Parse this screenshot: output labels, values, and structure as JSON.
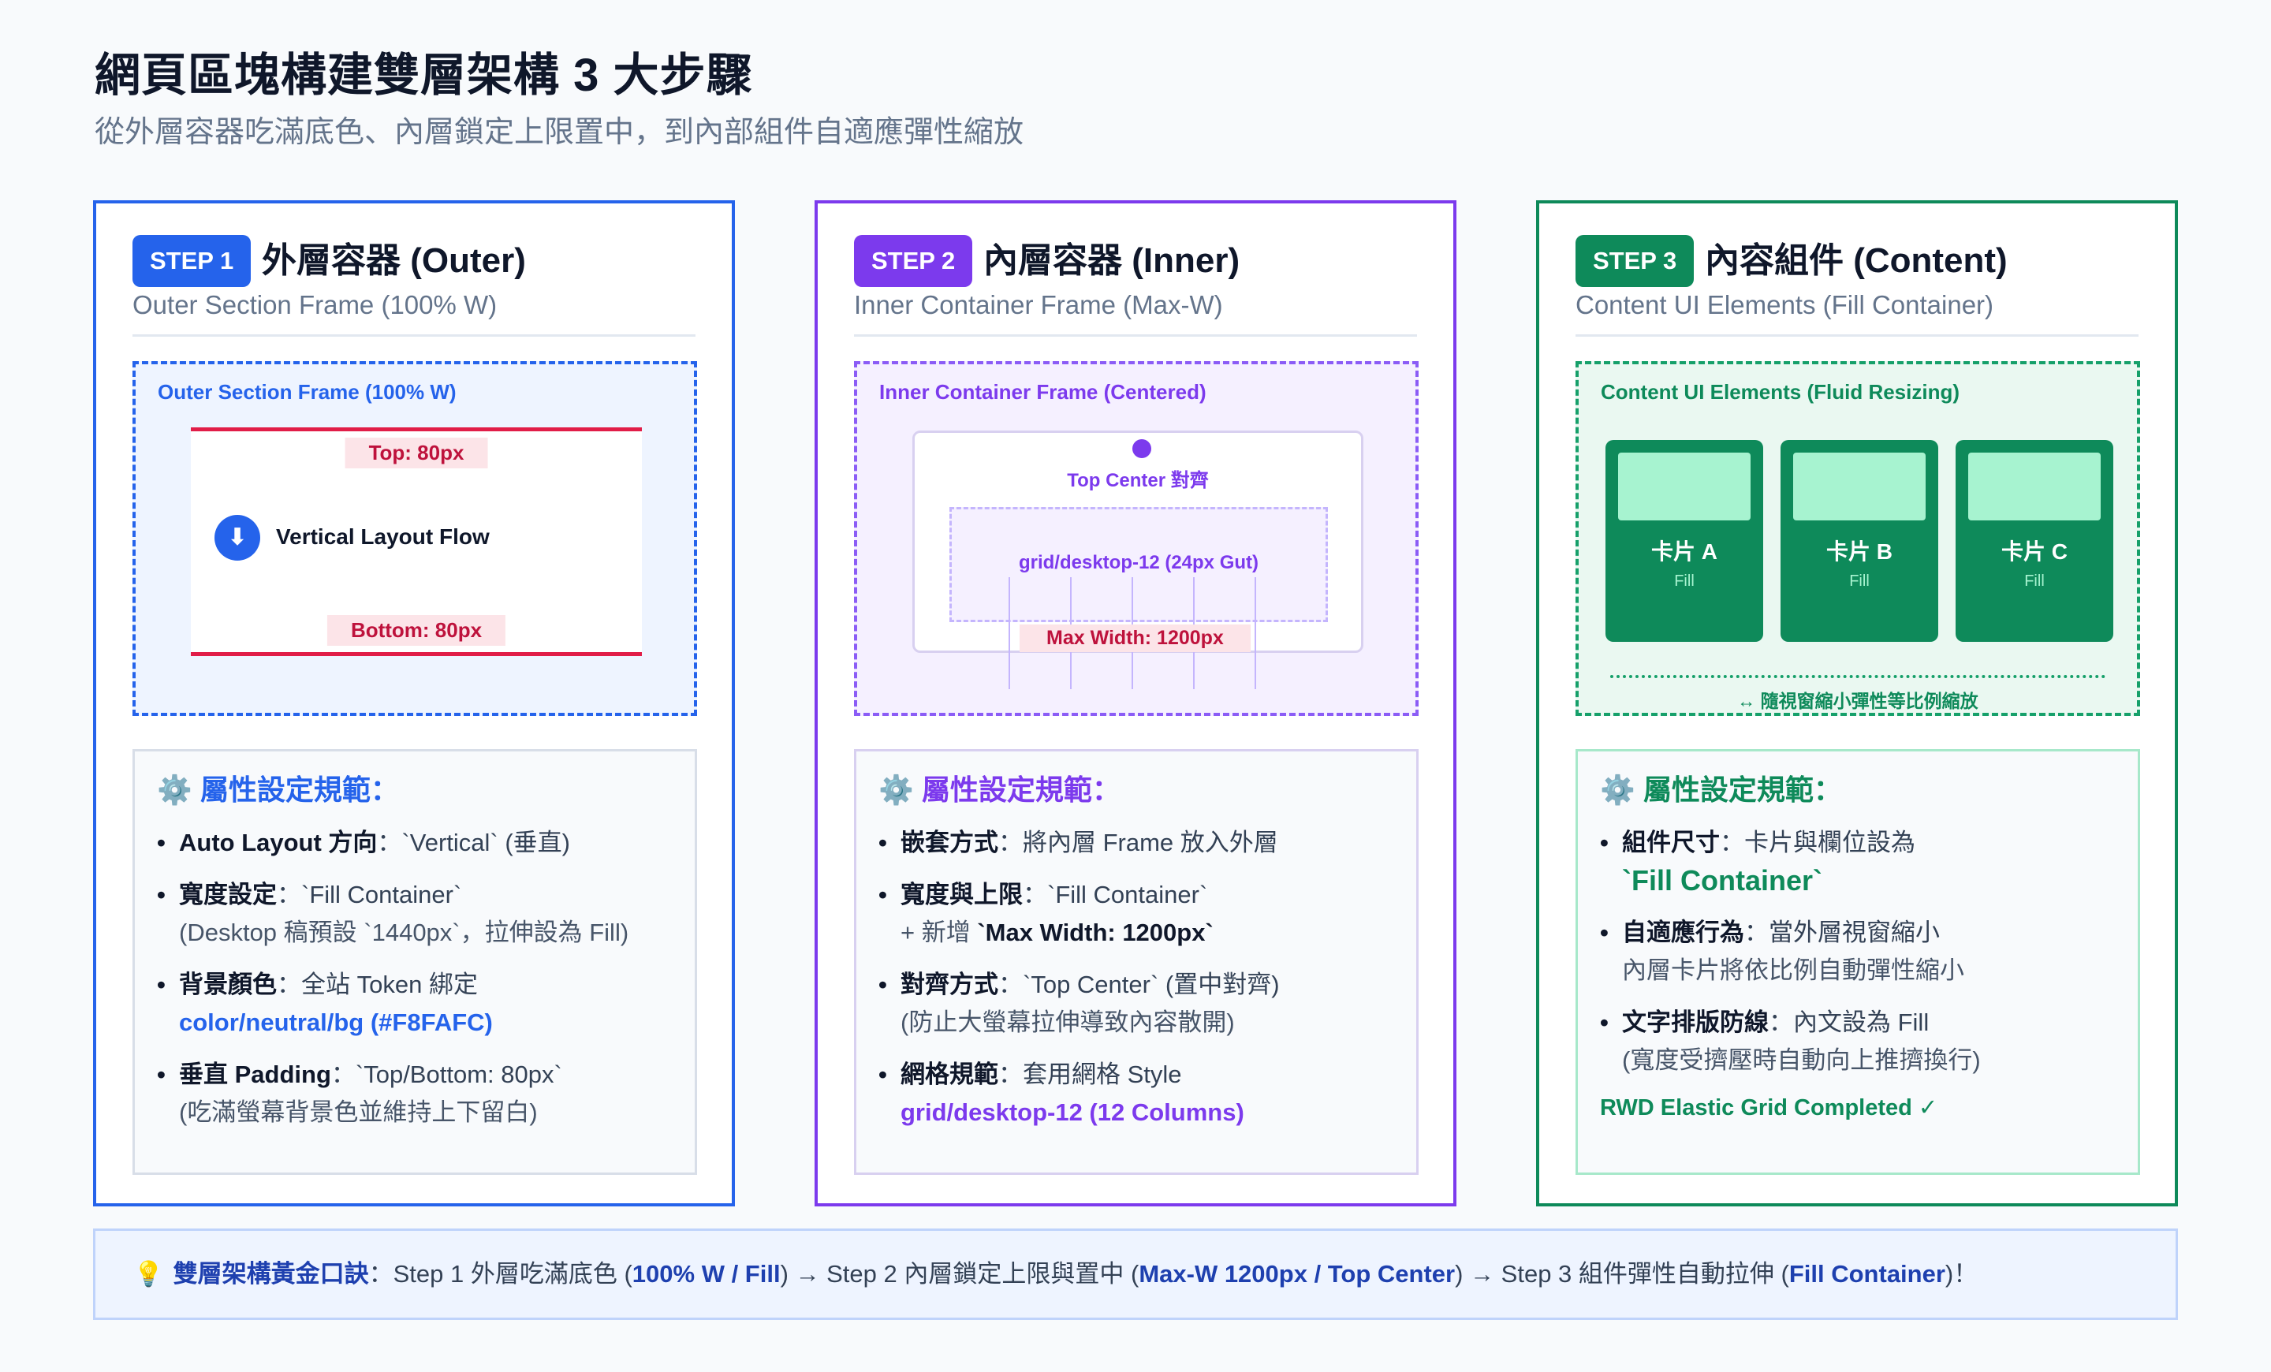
{
  "header": {
    "title": "網頁區塊構建雙層架構 3 大步驟",
    "subtitle": "從外層容器吃滿底色、內層鎖定上限置中，到內部組件自適應彈性縮放"
  },
  "colors": {
    "step1": "#2563EB",
    "step2": "#7C3AED",
    "step3": "#0E8A5A",
    "padding_accent": "#E11D48",
    "background": "#F8FAFC"
  },
  "cards": [
    {
      "badge": "STEP 1",
      "title": "外層容器 (Outer)",
      "subtitle": "Outer Section Frame (100% W)",
      "frame_label": "Outer Section Frame (100% W)",
      "diagram": {
        "top_tag": "Top: 80px",
        "bottom_tag": "Bottom: 80px",
        "flow_icon": "arrow-down-icon",
        "flow_label": "Vertical Layout Flow"
      },
      "spec_title": "屬性設定規範：",
      "spec_icon": "gear-icon",
      "items": [
        {
          "key": "Auto Layout 方向",
          "value": "：`Vertical` (垂直)"
        },
        {
          "key": "寬度設定",
          "value": "：`Fill Container`",
          "sub": "(Desktop 稿預設 `1440px`，拉伸設為 Fill)"
        },
        {
          "key": "背景顏色",
          "value": "：全站 Token 綁定",
          "token": "color/neutral/bg (#F8FAFC)"
        },
        {
          "key": "垂直 Padding",
          "value": "：`Top/Bottom: 80px`",
          "sub": "(吃滿螢幕背景色並維持上下留白)"
        }
      ]
    },
    {
      "badge": "STEP 2",
      "title": "內層容器 (Inner)",
      "subtitle": "Inner Container Frame (Max-W)",
      "frame_label": "Inner Container Frame (Centered)",
      "diagram": {
        "center_label": "Top Center 對齊",
        "grid_label": "grid/desktop-12 (24px Gut)",
        "maxw_tag": "Max Width: 1200px"
      },
      "spec_title": "屬性設定規範：",
      "spec_icon": "gear-icon",
      "items": [
        {
          "key": "嵌套方式",
          "value": "：將內層 Frame 放入外層"
        },
        {
          "key": "寬度與上限",
          "value": "：`Fill Container`",
          "sub_prefix": "+ 新增 ",
          "sub_bold": "`Max Width: 1200px`"
        },
        {
          "key": "對齊方式",
          "value": "：`Top Center` (置中對齊)",
          "sub": "(防止大螢幕拉伸導致內容散開)"
        },
        {
          "key": "網格規範",
          "value": "：套用網格 Style",
          "token": "grid/desktop-12 (12 Columns)"
        }
      ]
    },
    {
      "badge": "STEP 3",
      "title": "內容組件 (Content)",
      "subtitle": "Content UI Elements (Fill Container)",
      "frame_label": "Content UI Elements (Fluid Resizing)",
      "diagram": {
        "cards": [
          {
            "name": "卡片 A",
            "fill": "Fill"
          },
          {
            "name": "卡片 B",
            "fill": "Fill"
          },
          {
            "name": "卡片 C",
            "fill": "Fill"
          }
        ],
        "resize_label": "↔ 隨視窗縮小彈性等比例縮放"
      },
      "spec_title": "屬性設定規範：",
      "spec_icon": "gear-icon",
      "items": [
        {
          "key": "組件尺寸",
          "value": "：卡片與欄位設為",
          "token": "`Fill Container`"
        },
        {
          "key": "自適應行為",
          "value": "：當外層視窗縮小",
          "sub": "內層卡片將依比例自動彈性縮小"
        },
        {
          "key": "文字排版防線",
          "value": "：內文設為 Fill",
          "sub": "(寬度受擠壓時自動向上推擠換行)"
        }
      ],
      "completed": "RWD Elastic Grid Completed ✓"
    }
  ],
  "footer": {
    "icon": "lightbulb-icon",
    "label": "雙層架構黃金口訣",
    "p1": "：Step 1 外層吃滿底色 (",
    "b1": "100% W / Fill",
    "p2": ") → Step 2 內層鎖定上限與置中 (",
    "b2": "Max-W 1200px / Top Center",
    "p3": ") → Step 3 組件彈性自動拉伸 (",
    "b3": "Fill Container",
    "p4": ")！"
  }
}
